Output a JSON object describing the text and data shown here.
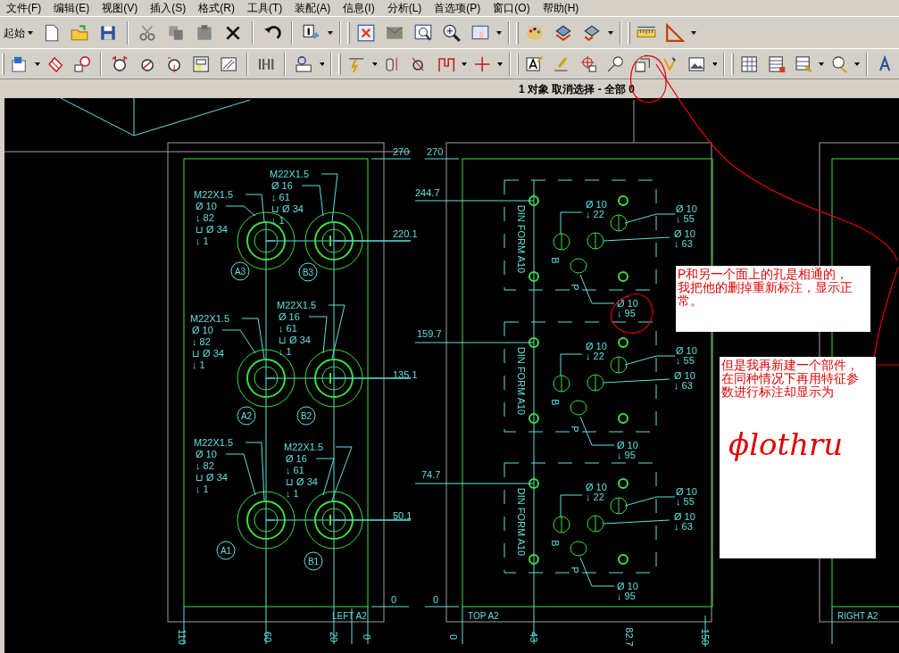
{
  "menu": [
    "文件(F)",
    "编辑(E)",
    "视图(V)",
    "插入(S)",
    "格式(R)",
    "工具(T)",
    "装配(A)",
    "信息(I)",
    "分析(L)",
    "首选项(P)",
    "窗口(O)",
    "帮助(H)"
  ],
  "toolbar": {
    "start_label": "起始"
  },
  "status_bar": {
    "text": "1 对象 取消选择 - 全部 0"
  },
  "left_view": {
    "title": "LEFT A2",
    "height_dims": [
      "270",
      "220.1",
      "135.1",
      "50.1",
      "0"
    ],
    "width_dims": [
      "110",
      "60",
      "20",
      "0"
    ],
    "holes": [
      {
        "port": "A3",
        "callout": [
          "M22X1.5",
          "Ø 10",
          "↓ 82",
          "⊔ Ø 34",
          "↓ 1"
        ]
      },
      {
        "port": "B3",
        "callout": [
          "M22X1.5",
          "Ø 16",
          "↓ 61",
          "⊔ Ø 34",
          "↓ 1"
        ]
      },
      {
        "port": "A2",
        "callout": [
          "M22X1.5",
          "Ø 10",
          "↓ 82",
          "⊔ Ø 34",
          "↓ 1"
        ]
      },
      {
        "port": "B2",
        "callout": [
          "M22X1.5",
          "Ø 16",
          "↓ 61",
          "⊔ Ø 34",
          "↓ 1"
        ]
      },
      {
        "port": "A1",
        "callout": [
          "M22X1.5",
          "Ø 10",
          "↓ 82",
          "⊔ Ø 34",
          "↓ 1"
        ]
      },
      {
        "port": "B1",
        "callout": [
          "M22X1.5",
          "Ø 16",
          "↓ 61",
          "⊔ Ø 34",
          "↓ 1"
        ]
      }
    ]
  },
  "top_view": {
    "title": "TOP A2",
    "height_dims": [
      "270",
      "244.7",
      "159.7",
      "74.7",
      "0"
    ],
    "width_dims": [
      "0",
      "43",
      "82.7",
      "150"
    ],
    "valve_patterns": [
      {
        "standard": "DIN FORM A10",
        "port_labels": [
          "B",
          "P"
        ],
        "callouts": [
          [
            "Ø 10",
            "↓ 22"
          ],
          [
            "Ø 10",
            "↓ 55"
          ],
          [
            "Ø 10",
            "↓ 63"
          ],
          [
            "Ø 10",
            "↓ 95"
          ]
        ]
      },
      {
        "standard": "DIN FORM A10",
        "port_labels": [
          "B",
          "P"
        ],
        "callouts": [
          [
            "Ø 10",
            "↓ 22"
          ],
          [
            "Ø 10",
            "↓ 55"
          ],
          [
            "Ø 10",
            "↓ 63"
          ],
          [
            "Ø 10",
            "↓ 95"
          ]
        ]
      },
      {
        "standard": "DIN FORM A10",
        "port_labels": [
          "B",
          "P"
        ],
        "callouts": [
          [
            "Ø 10",
            "↓ 22"
          ],
          [
            "Ø 10",
            "↓ 55"
          ],
          [
            "Ø 10",
            "↓ 63"
          ],
          [
            "Ø 10",
            "↓ 95"
          ]
        ]
      }
    ]
  },
  "right_view": {
    "title": "RIGHT A2"
  },
  "notes": [
    {
      "text": "P和另一个面上的孔是相通的，我把他的删掉重新标注，显示正常。"
    },
    {
      "text": "但是我再新建一个部件，在同种情况下再用特征参数进行标注却显示为",
      "handwriting": "ϕlothru"
    }
  ]
}
